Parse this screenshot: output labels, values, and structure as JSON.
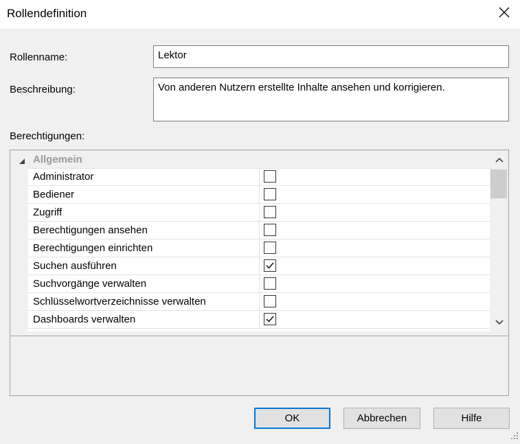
{
  "window": {
    "title": "Rollendefinition"
  },
  "form": {
    "role_name_label": "Rollenname:",
    "role_name_value": "Lektor",
    "description_label": "Beschreibung:",
    "description_value": "Von anderen Nutzern erstellte Inhalte ansehen und korrigieren.",
    "permissions_label": "Berechtigungen:"
  },
  "permissions": {
    "category": "Allgemein",
    "items": [
      {
        "label": "Administrator",
        "checked": false
      },
      {
        "label": "Bediener",
        "checked": false
      },
      {
        "label": "Zugriff",
        "checked": false
      },
      {
        "label": "Berechtigungen ansehen",
        "checked": false
      },
      {
        "label": "Berechtigungen einrichten",
        "checked": false
      },
      {
        "label": "Suchen ausführen",
        "checked": true
      },
      {
        "label": "Suchvorgänge verwalten",
        "checked": false
      },
      {
        "label": "Schlüsselwortverzeichnisse verwalten",
        "checked": false
      },
      {
        "label": "Dashboards verwalten",
        "checked": true
      }
    ]
  },
  "buttons": {
    "ok": "OK",
    "cancel": "Abbrechen",
    "help": "Hilfe"
  },
  "colors": {
    "accent": "#0078d7",
    "window_bg": "#f0f0f0",
    "category_text": "#999999"
  }
}
